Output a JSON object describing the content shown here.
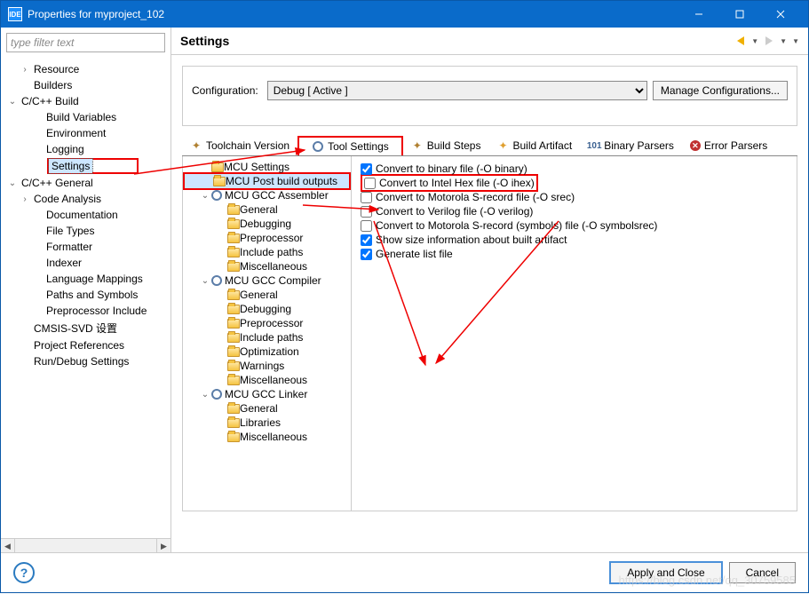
{
  "window": {
    "title": "Properties for myproject_102",
    "icon_text": "IDE"
  },
  "filter_placeholder": "type filter text",
  "nav_tree": [
    {
      "label": "Resource",
      "tw": "›",
      "cls": "ind1"
    },
    {
      "label": "Builders",
      "tw": "",
      "cls": "ind1"
    },
    {
      "label": "C/C++ Build",
      "tw": "⌄",
      "cls": ""
    },
    {
      "label": "Build Variables",
      "tw": "",
      "cls": "ind2"
    },
    {
      "label": "Environment",
      "tw": "",
      "cls": "ind2"
    },
    {
      "label": "Logging",
      "tw": "",
      "cls": "ind2"
    },
    {
      "label": "Settings",
      "tw": "",
      "cls": "ind2",
      "sel": true,
      "hl": true
    },
    {
      "label": "C/C++ General",
      "tw": "⌄",
      "cls": ""
    },
    {
      "label": "Code Analysis",
      "tw": "›",
      "cls": "ind1 ind2x",
      "indent": "ind2",
      "tw2": "›"
    },
    {
      "label": "Documentation",
      "tw": "",
      "cls": "ind2"
    },
    {
      "label": "File Types",
      "tw": "",
      "cls": "ind2"
    },
    {
      "label": "Formatter",
      "tw": "",
      "cls": "ind2"
    },
    {
      "label": "Indexer",
      "tw": "",
      "cls": "ind2"
    },
    {
      "label": "Language Mappings",
      "tw": "",
      "cls": "ind2"
    },
    {
      "label": "Paths and Symbols",
      "tw": "",
      "cls": "ind2"
    },
    {
      "label": "Preprocessor Include",
      "tw": "",
      "cls": "ind2"
    },
    {
      "label": "CMSIS-SVD 设置",
      "tw": "",
      "cls": "ind1"
    },
    {
      "label": "Project References",
      "tw": "",
      "cls": "ind1"
    },
    {
      "label": "Run/Debug Settings",
      "tw": "",
      "cls": "ind1"
    }
  ],
  "page_title": "Settings",
  "config": {
    "label": "Configuration:",
    "value": "Debug  [ Active ]",
    "manage": "Manage Configurations..."
  },
  "tabs": [
    {
      "label": "Toolchain  Version",
      "icon": "wand",
      "name": "tab-toolchain-version"
    },
    {
      "label": "Tool Settings",
      "icon": "gear",
      "hl": true,
      "name": "tab-tool-settings"
    },
    {
      "label": "Build Steps",
      "icon": "wand",
      "name": "tab-build-steps"
    },
    {
      "label": "Build Artifact",
      "icon": "star",
      "name": "tab-build-artifact"
    },
    {
      "label": "Binary Parsers",
      "icon": "bin",
      "name": "tab-binary-parsers"
    },
    {
      "label": "Error Parsers",
      "icon": "err",
      "name": "tab-error-parsers"
    }
  ],
  "tool_tree": [
    {
      "label": "MCU Settings",
      "tw": "",
      "cls": "i1",
      "icon": "folder"
    },
    {
      "label": "MCU Post build outputs",
      "tw": "",
      "cls": "i1",
      "icon": "folder",
      "sel": true,
      "hl": true
    },
    {
      "label": "MCU GCC Assembler",
      "tw": "⌄",
      "cls": "i1",
      "icon": "gear"
    },
    {
      "label": "General",
      "tw": "",
      "cls": "i2",
      "icon": "folder"
    },
    {
      "label": "Debugging",
      "tw": "",
      "cls": "i2",
      "icon": "folder"
    },
    {
      "label": "Preprocessor",
      "tw": "",
      "cls": "i2",
      "icon": "folder"
    },
    {
      "label": "Include paths",
      "tw": "",
      "cls": "i2",
      "icon": "folder"
    },
    {
      "label": "Miscellaneous",
      "tw": "",
      "cls": "i2",
      "icon": "folder"
    },
    {
      "label": "MCU GCC Compiler",
      "tw": "⌄",
      "cls": "i1",
      "icon": "gear"
    },
    {
      "label": "General",
      "tw": "",
      "cls": "i2",
      "icon": "folder"
    },
    {
      "label": "Debugging",
      "tw": "",
      "cls": "i2",
      "icon": "folder"
    },
    {
      "label": "Preprocessor",
      "tw": "",
      "cls": "i2",
      "icon": "folder"
    },
    {
      "label": "Include paths",
      "tw": "",
      "cls": "i2",
      "icon": "folder"
    },
    {
      "label": "Optimization",
      "tw": "",
      "cls": "i2",
      "icon": "folder"
    },
    {
      "label": "Warnings",
      "tw": "",
      "cls": "i2",
      "icon": "folder"
    },
    {
      "label": "Miscellaneous",
      "tw": "",
      "cls": "i2",
      "icon": "folder"
    },
    {
      "label": "MCU GCC Linker",
      "tw": "⌄",
      "cls": "i1",
      "icon": "gear"
    },
    {
      "label": "General",
      "tw": "",
      "cls": "i2",
      "icon": "folder"
    },
    {
      "label": "Libraries",
      "tw": "",
      "cls": "i2",
      "icon": "folder"
    },
    {
      "label": "Miscellaneous",
      "tw": "",
      "cls": "i2",
      "icon": "folder"
    }
  ],
  "options": [
    {
      "label": "Convert to binary file (-O binary)",
      "checked": true
    },
    {
      "label": "Convert to Intel Hex file (-O ihex)",
      "checked": false,
      "hl": true
    },
    {
      "label": "Convert to Motorola S-record file (-O srec)",
      "checked": false
    },
    {
      "label": "Convert to Verilog file (-O verilog)",
      "checked": false
    },
    {
      "label": "Convert to Motorola S-record (symbols) file (-O symbolsrec)",
      "checked": false
    },
    {
      "label": "Show size information about built artifact",
      "checked": true
    },
    {
      "label": "Generate list file",
      "checked": true
    }
  ],
  "footer": {
    "apply": "Apply and Close",
    "cancel": "Cancel"
  },
  "watermark": "https://blog.csdn.net/qq_30759585"
}
